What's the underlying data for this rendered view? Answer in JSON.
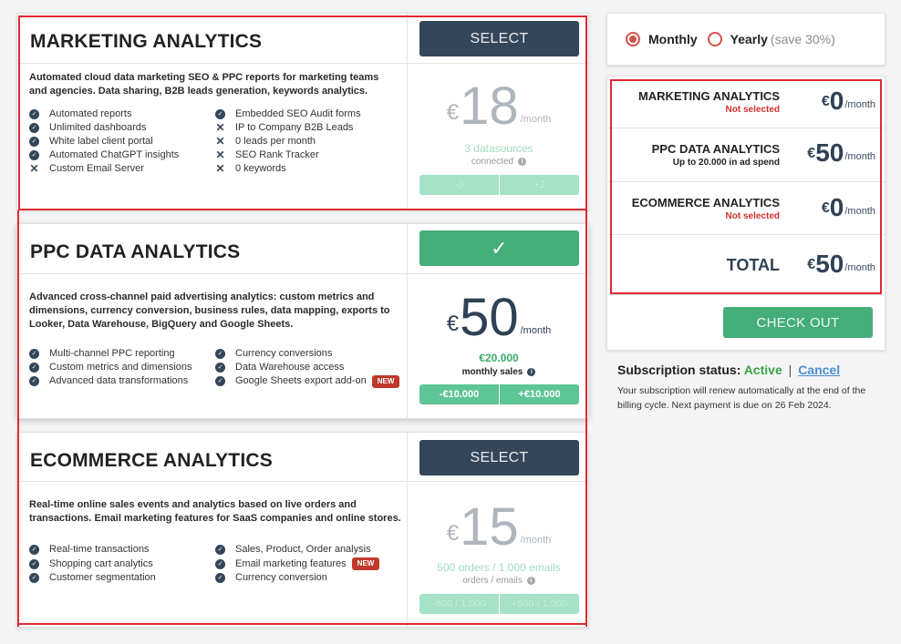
{
  "plans": [
    {
      "title": "MARKETING ANALYTICS",
      "description": "Automated cloud data marketing SEO & PPC reports for marketing teams and agencies. Data sharing, B2B leads generation, keywords analytics.",
      "features_left": [
        {
          "label": "Automated reports",
          "included": true
        },
        {
          "label": "Unlimited dashboards",
          "included": true
        },
        {
          "label": "White label client portal",
          "included": true
        },
        {
          "label": "Automated ChatGPT insights",
          "included": true
        },
        {
          "label": "Custom Email Server",
          "included": false
        }
      ],
      "features_right": [
        {
          "label": "Embedded SEO Audit forms",
          "included": true
        },
        {
          "label": "IP to Company B2B Leads",
          "included": false
        },
        {
          "label": "0 leads per month",
          "included": false
        },
        {
          "label": "SEO Rank Tracker",
          "included": false
        },
        {
          "label": "0 keywords",
          "included": false
        }
      ],
      "button_label": "SELECT",
      "selected": false,
      "currency": "€",
      "price": "18",
      "period": "/month",
      "quantity": "3 datasources",
      "quantity_sub": "connected",
      "stepper_minus": "-0",
      "stepper_plus": "+2"
    },
    {
      "title": "PPC DATA ANALYTICS",
      "description": "Advanced cross-channel paid advertising analytics: custom metrics and dimensions, currency conversion, business rules, data mapping, exports to Looker, Data Warehouse, BigQuery and Google Sheets.",
      "features_left": [
        {
          "label": "Multi-channel PPC reporting",
          "included": true
        },
        {
          "label": "Custom metrics and dimensions",
          "included": true
        },
        {
          "label": "Advanced data transformations",
          "included": true
        }
      ],
      "features_right": [
        {
          "label": "Currency conversions",
          "included": true
        },
        {
          "label": "Data Warehouse access",
          "included": true
        },
        {
          "label": "Google Sheets export add-on",
          "included": true,
          "badge": "NEW"
        }
      ],
      "button_label": "✓",
      "selected": true,
      "currency": "€",
      "price": "50",
      "period": "/month",
      "quantity": "€20.000",
      "quantity_sub": "monthly sales",
      "stepper_minus": "-€10.000",
      "stepper_plus": "+€10.000"
    },
    {
      "title": "ECOMMERCE ANALYTICS",
      "description": "Real-time online sales events and analytics based on live orders and transactions. Email marketing features for SaaS companies and online stores.",
      "features_left": [
        {
          "label": "Real-time transactions",
          "included": true
        },
        {
          "label": "Shopping cart analytics",
          "included": true
        },
        {
          "label": "Customer segmentation",
          "included": true
        }
      ],
      "features_right": [
        {
          "label": "Sales, Product, Order analysis",
          "included": true
        },
        {
          "label": "Email marketing features",
          "included": true,
          "badge": "NEW"
        },
        {
          "label": "Currency conversion",
          "included": true
        }
      ],
      "button_label": "SELECT",
      "selected": false,
      "currency": "€",
      "price": "15",
      "period": "/month",
      "quantity": "500 orders / 1.000 emails",
      "quantity_sub": "orders / emails",
      "stepper_minus": "-500 / 1.000",
      "stepper_plus": "+500 / 1.000"
    }
  ],
  "billing": {
    "monthly_label": "Monthly",
    "yearly_label": "Yearly",
    "yearly_note": "(save 30%)",
    "selected": "monthly"
  },
  "summary": {
    "rows": [
      {
        "name": "MARKETING ANALYTICS",
        "sub": "Not selected",
        "sub_type": "red",
        "currency": "€",
        "amount": "0",
        "period": "/month"
      },
      {
        "name": "PPC DATA ANALYTICS",
        "sub": "Up to 20.000 in ad spend",
        "sub_type": "dark",
        "currency": "€",
        "amount": "50",
        "period": "/month"
      },
      {
        "name": "ECOMMERCE ANALYTICS",
        "sub": "Not selected",
        "sub_type": "red",
        "currency": "€",
        "amount": "0",
        "period": "/month"
      }
    ],
    "total_label": "TOTAL",
    "total_currency": "€",
    "total_amount": "50",
    "total_period": "/month",
    "checkout_label": "CHECK OUT"
  },
  "subscription": {
    "label": "Subscription status:",
    "status": "Active",
    "separator": "|",
    "cancel_label": "Cancel",
    "renew_text": "Your subscription will renew automatically at the end of the billing cycle. Next payment is due on 26 Feb 2024."
  },
  "icons": {
    "included": "check-circle-icon",
    "excluded": "x-icon",
    "info": "info-icon"
  }
}
